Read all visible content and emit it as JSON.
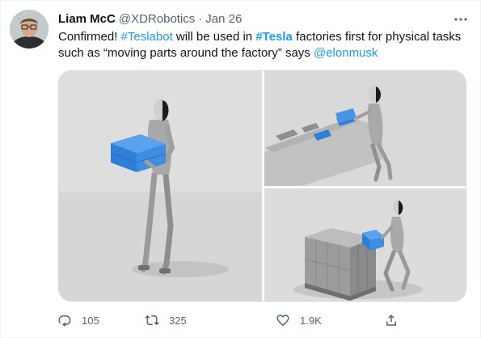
{
  "author": {
    "name": "Liam McC",
    "handle": "@XDRobotics",
    "separator": "·",
    "date": "Jan 26"
  },
  "tweet": {
    "segments": [
      {
        "text": "Confirmed! ",
        "kind": "plain"
      },
      {
        "text": "#Teslabot",
        "kind": "hashtag"
      },
      {
        "text": " will be used in ",
        "kind": "plain"
      },
      {
        "text": "#Tesla",
        "kind": "hashtag-bold"
      },
      {
        "text": " factories first for physical tasks such as “moving parts around the factory” says ",
        "kind": "plain"
      },
      {
        "text": "@elonmusk",
        "kind": "mention"
      }
    ]
  },
  "media": {
    "images": [
      {
        "name": "robot-holding-box-image"
      },
      {
        "name": "robot-at-conveyor-image"
      },
      {
        "name": "robot-stacking-pallet-image"
      }
    ]
  },
  "actions": {
    "reply": {
      "count": "105",
      "icon": "reply-icon"
    },
    "retweet": {
      "count": "325",
      "icon": "retweet-icon"
    },
    "like": {
      "count": "1.9K",
      "icon": "heart-icon"
    },
    "share": {
      "icon": "share-icon"
    }
  },
  "colors": {
    "accent": "#1d9bf0",
    "text": "#0f1419",
    "muted": "#536471",
    "border": "#cfd9de",
    "box_blue": "#2f7fd6"
  }
}
